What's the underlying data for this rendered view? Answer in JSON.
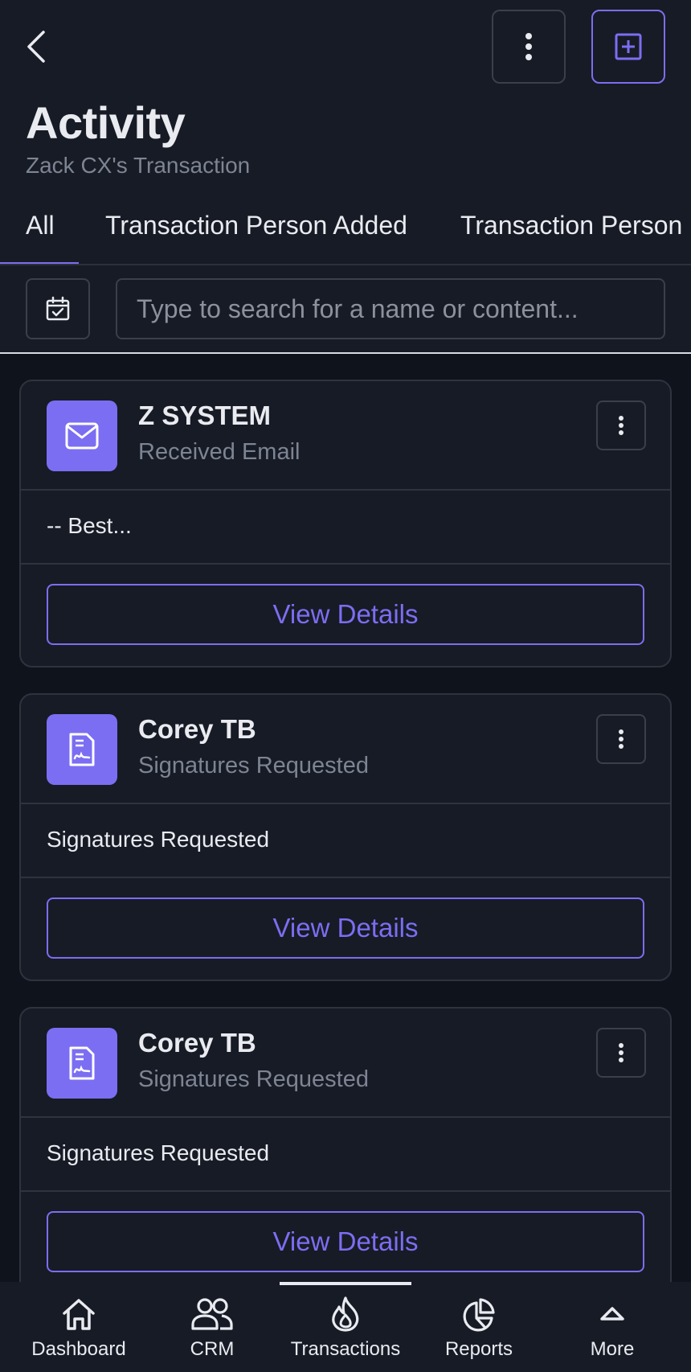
{
  "header": {
    "title": "Activity",
    "subtitle": "Zack CX's Transaction"
  },
  "tabs": [
    {
      "label": "All",
      "active": true
    },
    {
      "label": "Transaction Person Added"
    },
    {
      "label": "Transaction Person R"
    }
  ],
  "search": {
    "placeholder": "Type to search for a name or content...",
    "value": ""
  },
  "cards": [
    {
      "name": "Z SYSTEM",
      "type": "Received Email",
      "icon": "mail-icon",
      "preview": "-- Best...",
      "button": "View Details"
    },
    {
      "name": "Corey TB",
      "type": "Signatures Requested",
      "icon": "document-signature-icon",
      "preview": "Signatures Requested",
      "button": "View Details"
    },
    {
      "name": "Corey TB",
      "type": "Signatures Requested",
      "icon": "document-signature-icon",
      "preview": "Signatures Requested",
      "button": "View Details"
    }
  ],
  "nav": [
    {
      "label": "Dashboard",
      "icon": "home-icon"
    },
    {
      "label": "CRM",
      "icon": "users-icon"
    },
    {
      "label": "Transactions",
      "icon": "flame-icon",
      "active": true
    },
    {
      "label": "Reports",
      "icon": "pie-chart-icon"
    },
    {
      "label": "More",
      "icon": "chevron-up-icon"
    }
  ],
  "colors": {
    "accent": "#7b6ef2",
    "background": "#0f131b",
    "surface": "#171b25"
  }
}
